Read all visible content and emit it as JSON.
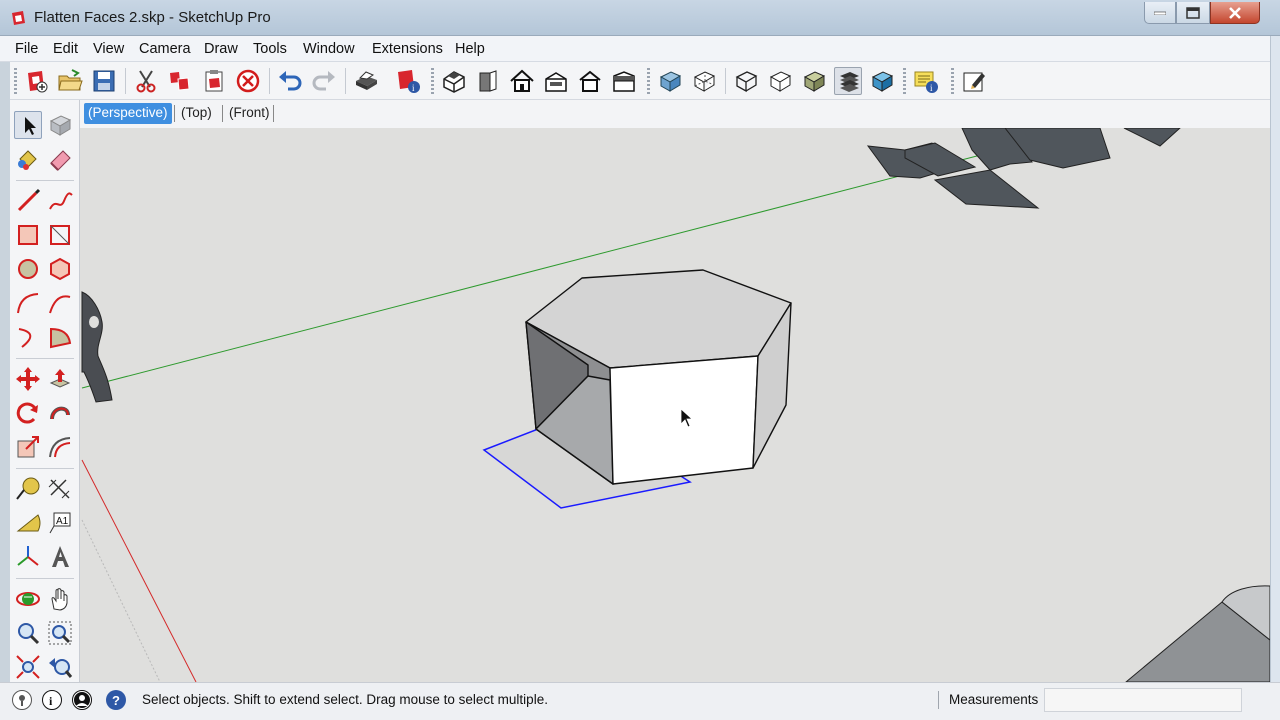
{
  "window": {
    "title": "Flatten Faces 2.skp - SketchUp Pro"
  },
  "menu": [
    "File",
    "Edit",
    "View",
    "Camera",
    "Draw",
    "Tools",
    "Window",
    "Extensions",
    "Help"
  ],
  "toolbar": {
    "buttons": [
      "new-file-icon",
      "open-file-icon",
      "save-icon",
      "cut-icon",
      "copy-icon",
      "paste-icon",
      "erase-icon",
      "undo-icon",
      "redo-icon",
      "print-icon",
      "model-info-icon",
      "iso-view-icon",
      "front-view-icon",
      "top-view-icon",
      "right-view-icon",
      "back-view-icon",
      "left-view-icon",
      "xray-icon",
      "back-edges-icon",
      "wireframe-icon",
      "hidden-line-icon",
      "shaded-icon",
      "shaded-textures-icon",
      "monochrome-icon",
      "tips-icon",
      "extension-icon"
    ]
  },
  "scenes": [
    {
      "label": "(Perspective)",
      "active": true
    },
    {
      "label": "(Top)",
      "active": false
    },
    {
      "label": "(Front)",
      "active": false
    }
  ],
  "status": {
    "text": "Select objects. Shift to extend select. Drag mouse to select multiple.",
    "measurements_label": "Measurements",
    "measurements_value": ""
  },
  "colors": {
    "active_scene": "#3f8fe0",
    "viewport_bg": "#dfdfdd",
    "green_axis": "#2e9a2e",
    "red_axis": "#d42a2a",
    "selection_blue": "#1a1aff"
  }
}
